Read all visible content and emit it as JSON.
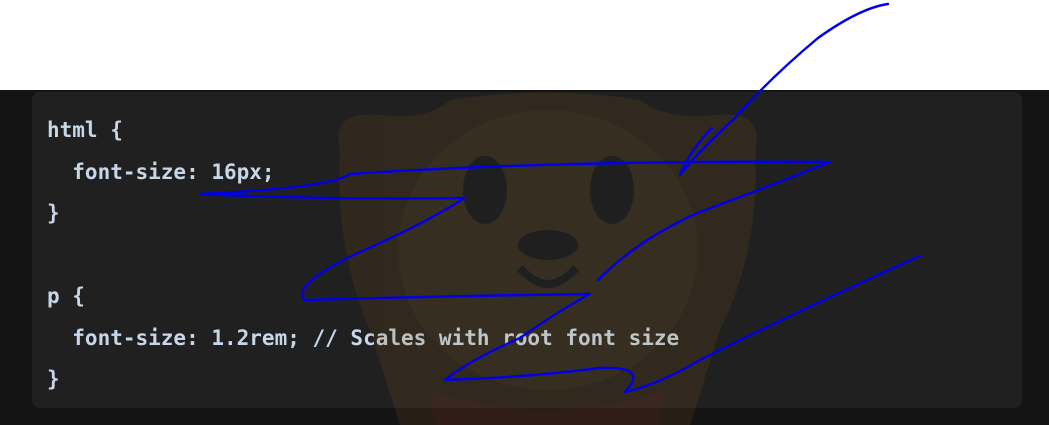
{
  "code": {
    "lines": [
      "html {",
      "  font-size: 16px;",
      "}",
      "",
      "p {",
      "  font-size: 1.2rem; // Scales with root font size",
      "}"
    ]
  },
  "colors": {
    "code_background": "#202020",
    "code_text": "#c7d6e8",
    "annotation_stroke": "#0000e6",
    "watermark": "#3a2a10"
  },
  "icons": {
    "watermark": "cartoon-face-watermark-icon"
  }
}
